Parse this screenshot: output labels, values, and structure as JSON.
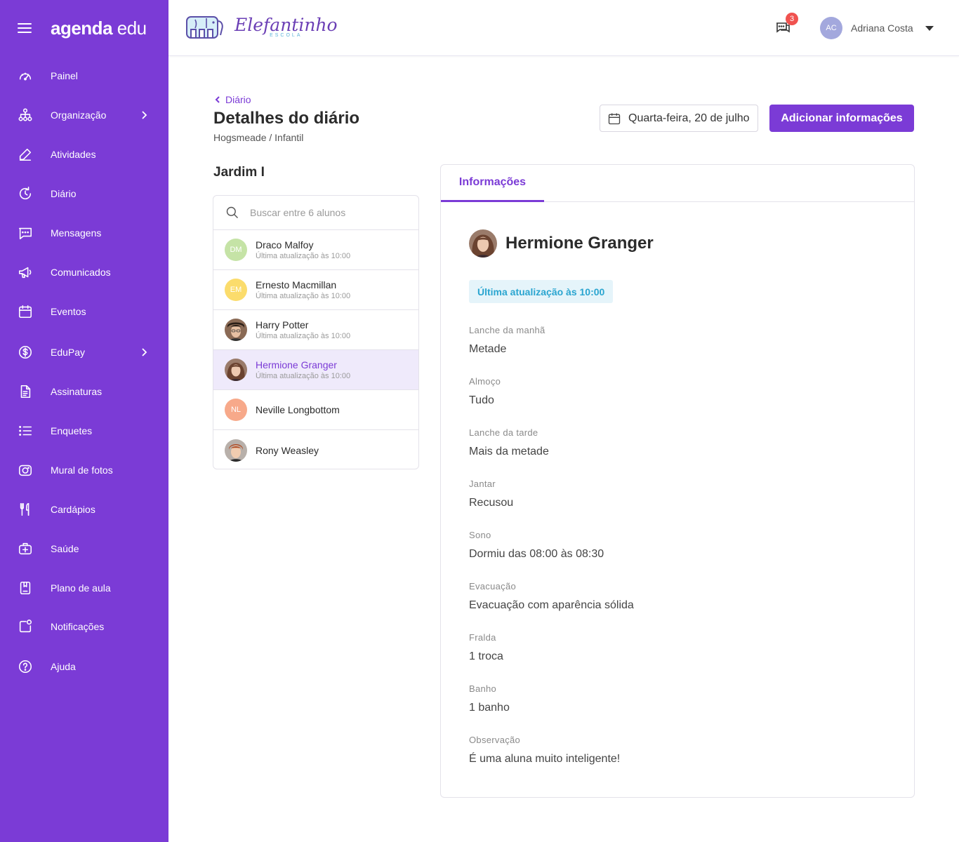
{
  "brand": {
    "logo_bold": "agenda",
    "logo_light": "edu"
  },
  "sidebar": {
    "items": [
      {
        "label": "Painel",
        "icon": "dashboard-icon"
      },
      {
        "label": "Organização",
        "icon": "organization-icon",
        "has_submenu": true
      },
      {
        "label": "Atividades",
        "icon": "pencil-icon"
      },
      {
        "label": "Diário",
        "icon": "refresh-clock-icon"
      },
      {
        "label": "Mensagens",
        "icon": "message-icon"
      },
      {
        "label": "Comunicados",
        "icon": "megaphone-icon"
      },
      {
        "label": "Eventos",
        "icon": "calendar-icon"
      },
      {
        "label": "EduPay",
        "icon": "dollar-icon",
        "has_submenu": true
      },
      {
        "label": "Assinaturas",
        "icon": "document-icon"
      },
      {
        "label": "Enquetes",
        "icon": "list-icon"
      },
      {
        "label": "Mural de fotos",
        "icon": "camera-icon"
      },
      {
        "label": "Cardápios",
        "icon": "cutlery-icon"
      },
      {
        "label": "Saúde",
        "icon": "medical-kit-icon"
      },
      {
        "label": "Plano de aula",
        "icon": "book-icon"
      },
      {
        "label": "Notificações",
        "icon": "notification-icon"
      },
      {
        "label": "Ajuda",
        "icon": "help-icon"
      }
    ]
  },
  "header": {
    "school_name": "Elefantinho",
    "school_sub": "ESCOLA",
    "chat_badge": "3",
    "user_initials": "AC",
    "user_name": "Adriana Costa"
  },
  "main": {
    "back_label": "Diário",
    "title": "Detalhes do diário",
    "subtitle": "Hogsmeade / Infantil",
    "date_label": "Quarta-feira, 20 de julho",
    "add_button": "Adicionar informações",
    "class_name": "Jardim I",
    "search_placeholder": "Buscar entre 6 alunos"
  },
  "students": [
    {
      "name": "Draco Malfoy",
      "sub": "Última atualização às 10:00",
      "initials": "DM",
      "color": "#c5e3a6"
    },
    {
      "name": "Ernesto Macmillan",
      "sub": "Última atualização às 10:00",
      "initials": "EM",
      "color": "#fbdc6c"
    },
    {
      "name": "Harry Potter",
      "sub": "Última atualização às 10:00",
      "initials": "",
      "photo": true
    },
    {
      "name": "Hermione Granger",
      "sub": "Última atualização às 10:00",
      "initials": "",
      "photo": true,
      "active": true
    },
    {
      "name": "Neville Longbottom",
      "sub": "",
      "initials": "NL",
      "color": "#f7a98a"
    },
    {
      "name": "Rony Weasley",
      "sub": "",
      "initials": "",
      "photo": true
    }
  ],
  "details": {
    "tab": "Informações",
    "student_name": "Hermione Granger",
    "update_chip": "Última atualização às 10:00",
    "fields": [
      {
        "label": "Lanche da manhã",
        "value": "Metade"
      },
      {
        "label": "Almoço",
        "value": "Tudo"
      },
      {
        "label": "Lanche da tarde",
        "value": "Mais da metade"
      },
      {
        "label": "Jantar",
        "value": "Recusou"
      },
      {
        "label": "Sono",
        "value": "Dormiu das 08:00 às 08:30"
      },
      {
        "label": "Evacuação",
        "value": "Evacuação com aparência sólida"
      },
      {
        "label": "Fralda",
        "value": "1 troca"
      },
      {
        "label": "Banho",
        "value": "1 banho"
      },
      {
        "label": "Observação",
        "value": "É uma aluna muito inteligente!"
      }
    ]
  },
  "colors": {
    "primary": "#7b3bd6",
    "badge": "#f0524f",
    "chip_bg": "#e5f4fa",
    "chip_text": "#2aa5d0"
  }
}
